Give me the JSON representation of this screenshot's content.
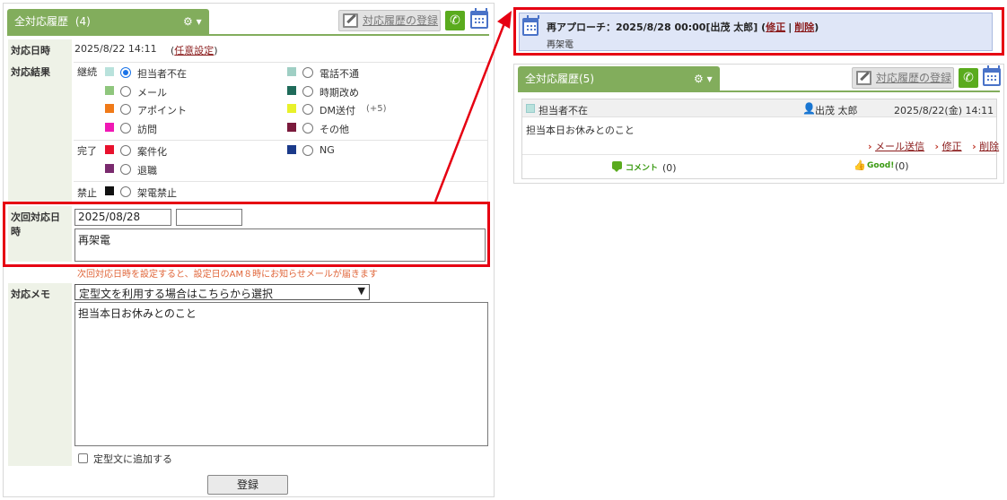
{
  "left": {
    "tab_title": "全対応履歴",
    "tab_count": "(4)",
    "register_label": "対応履歴の登録",
    "date_label": "対応日時",
    "date_value": "2025/8/22 14:11",
    "date_paren_open": "(",
    "date_link": "任意設定",
    "date_paren_close": ")",
    "result_label": "対応結果",
    "groups": {
      "continue": "継続",
      "done": "完了",
      "forbid": "禁止"
    },
    "options": [
      {
        "label": "担当者不在",
        "color": "#b9e2dc",
        "selected": true
      },
      {
        "label": "電話不通",
        "color": "#9fcfc4"
      },
      {
        "label": "メール",
        "color": "#8fc67d"
      },
      {
        "label": "時期改め",
        "color": "#1f6b5a"
      },
      {
        "label": "アポイント",
        "color": "#f07a18"
      },
      {
        "label": "DM送付",
        "color": "#e8f12a",
        "extra": "(+5)"
      },
      {
        "label": "訪問",
        "color": "#f018b4"
      },
      {
        "label": "その他",
        "color": "#7a1a3c"
      },
      {
        "label": "案件化",
        "color": "#e8112d"
      },
      {
        "label": "NG",
        "color": "#1b3a8a"
      },
      {
        "label": "退職",
        "color": "#7a2a6e"
      },
      {
        "label": "架電禁止",
        "color": "#111111"
      }
    ],
    "next_label": "次回対応日時",
    "next_date": "2025/08/28",
    "next_time": "",
    "next_note": "再架電",
    "hint": "次回対応日時を設定すると、設定日のAM８時にお知らせメールが届きます",
    "memo_label": "対応メモ",
    "template_select": "定型文を利用する場合はこちらから選択",
    "memo_text": "担当本日お休みとのこと",
    "add_template": "定型文に追加する",
    "submit": "登録"
  },
  "notice": {
    "title": "再アプローチ：2025/8/28 00:00[出茂 太郎] (",
    "edit": "修正",
    "sep": "|",
    "delete": "削除",
    "close": ")",
    "note": "再架電"
  },
  "right": {
    "tab_title": "全対応履歴(5)",
    "register_label": "対応履歴の登録",
    "entry": {
      "status": "担当者不在",
      "status_color": "#b9e2dc",
      "user": "出茂 太郎",
      "datetime": "2025/8/22(金) 14:11",
      "memo": "担当本日お休みとのこと",
      "mail": "メール送信",
      "edit": "修正",
      "delete": "削除",
      "comment_label": "コメント",
      "comment_count": "(0)",
      "good_label": "Good!",
      "good_count": "(0)"
    }
  },
  "colors": {
    "tab_green": "#82ad5c",
    "highlight_red": "#e60012",
    "link_red": "#8b1c1c"
  }
}
